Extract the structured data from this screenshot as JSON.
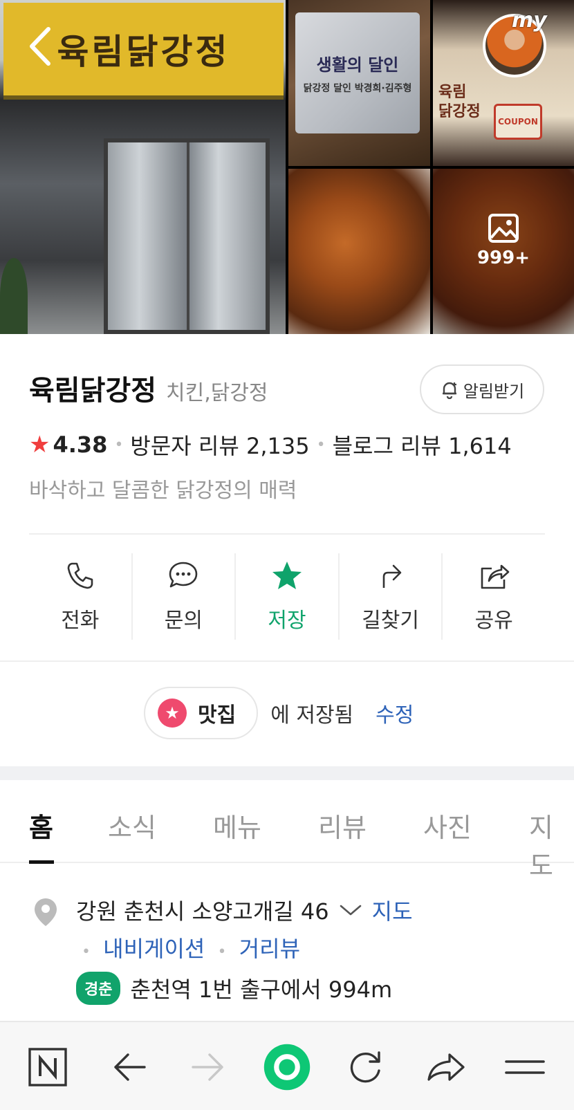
{
  "gallery": {
    "sign_text": "육림닭강정",
    "plaque_line1": "생활의 달인",
    "plaque_line2": "닭강정 달인 박경희·김주형",
    "box_text_1": "육림",
    "box_text_2": "닭강정",
    "coupon_text": "COUPON",
    "my_label": "my",
    "photo_count": "999+"
  },
  "place": {
    "name": "육림닭강정",
    "category": "치킨,닭강정",
    "alarm_label": "알림받기",
    "rating": "4.38",
    "visitor_reviews": "방문자 리뷰 2,135",
    "blog_reviews": "블로그 리뷰 1,614",
    "description": "바삭하고 달콤한 닭강정의 매력"
  },
  "actions": [
    {
      "label": "전화",
      "icon": "phone-icon"
    },
    {
      "label": "문의",
      "icon": "chat-icon"
    },
    {
      "label": "저장",
      "icon": "star-icon"
    },
    {
      "label": "길찾기",
      "icon": "directions-icon"
    },
    {
      "label": "공유",
      "icon": "share-icon"
    }
  ],
  "saved": {
    "folder_name": "맛집",
    "saved_text": "에 저장됨",
    "edit_label": "수정"
  },
  "tabs": [
    "홈",
    "소식",
    "메뉴",
    "리뷰",
    "사진",
    "지도"
  ],
  "location": {
    "address": "강원 춘천시 소양고개길 46",
    "map_link": "지도",
    "navigation_link": "내비게이션",
    "streetview_link": "거리뷰",
    "line_badge": "경춘",
    "station_info": "춘천역 1번 출구에서 994m"
  },
  "colors": {
    "accent_green": "#0fa36b",
    "link_blue": "#2e63b8",
    "rating_red": "#f03e3e",
    "folder_pink": "#ef4a6e"
  }
}
